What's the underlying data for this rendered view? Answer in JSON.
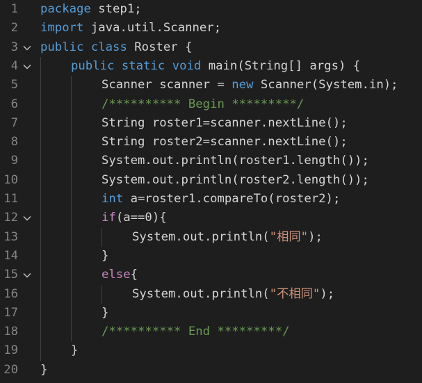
{
  "editor": {
    "language": "java",
    "lines": [
      {
        "num": "1",
        "fold": false,
        "indent": 0,
        "tokens": [
          {
            "t": "package",
            "c": "kw"
          },
          {
            "t": " step1;",
            "c": "tx"
          }
        ]
      },
      {
        "num": "2",
        "fold": false,
        "indent": 0,
        "tokens": [
          {
            "t": "import",
            "c": "kw"
          },
          {
            "t": " java.util.Scanner;",
            "c": "tx"
          }
        ]
      },
      {
        "num": "3",
        "fold": true,
        "indent": 0,
        "tokens": [
          {
            "t": "public",
            "c": "kw"
          },
          {
            "t": " ",
            "c": "tx"
          },
          {
            "t": "class",
            "c": "kw"
          },
          {
            "t": " Roster {",
            "c": "tx"
          }
        ]
      },
      {
        "num": "4",
        "fold": true,
        "indent": 1,
        "tokens": [
          {
            "t": "public",
            "c": "kw"
          },
          {
            "t": " ",
            "c": "tx"
          },
          {
            "t": "static",
            "c": "kw"
          },
          {
            "t": " ",
            "c": "tx"
          },
          {
            "t": "void",
            "c": "kw"
          },
          {
            "t": " main(String[] args) {",
            "c": "tx"
          }
        ]
      },
      {
        "num": "5",
        "fold": false,
        "indent": 2,
        "tokens": [
          {
            "t": "Scanner scanner = ",
            "c": "tx"
          },
          {
            "t": "new",
            "c": "kw"
          },
          {
            "t": " Scanner(System.in);",
            "c": "tx"
          }
        ]
      },
      {
        "num": "6",
        "fold": false,
        "indent": 2,
        "tokens": [
          {
            "t": "/********** Begin *********/",
            "c": "cmt"
          }
        ]
      },
      {
        "num": "7",
        "fold": false,
        "indent": 2,
        "tokens": [
          {
            "t": "String roster1=scanner.nextLine();",
            "c": "tx"
          }
        ]
      },
      {
        "num": "8",
        "fold": false,
        "indent": 2,
        "tokens": [
          {
            "t": "String roster2=scanner.nextLine();",
            "c": "tx"
          }
        ]
      },
      {
        "num": "9",
        "fold": false,
        "indent": 2,
        "tokens": [
          {
            "t": "System.out.println(roster1.length());",
            "c": "tx"
          }
        ]
      },
      {
        "num": "10",
        "fold": false,
        "indent": 2,
        "tokens": [
          {
            "t": "System.out.println(roster2.length());",
            "c": "tx"
          }
        ]
      },
      {
        "num": "11",
        "fold": false,
        "indent": 2,
        "tokens": [
          {
            "t": "int",
            "c": "kw"
          },
          {
            "t": " a=roster1.compareTo(roster2);",
            "c": "tx"
          }
        ]
      },
      {
        "num": "12",
        "fold": true,
        "indent": 2,
        "tokens": [
          {
            "t": "if",
            "c": "kw2"
          },
          {
            "t": "(a==0){",
            "c": "tx"
          }
        ]
      },
      {
        "num": "13",
        "fold": false,
        "indent": 3,
        "tokens": [
          {
            "t": "System.out.println(",
            "c": "tx"
          },
          {
            "t": "\"相同\"",
            "c": "str"
          },
          {
            "t": ");",
            "c": "tx"
          }
        ]
      },
      {
        "num": "14",
        "fold": false,
        "indent": 2,
        "tokens": [
          {
            "t": "}",
            "c": "tx"
          }
        ]
      },
      {
        "num": "15",
        "fold": true,
        "indent": 2,
        "tokens": [
          {
            "t": "else",
            "c": "kw2"
          },
          {
            "t": "{",
            "c": "tx"
          }
        ]
      },
      {
        "num": "16",
        "fold": false,
        "indent": 3,
        "tokens": [
          {
            "t": "System.out.println(",
            "c": "tx"
          },
          {
            "t": "\"不相同\"",
            "c": "str"
          },
          {
            "t": ");",
            "c": "tx"
          }
        ]
      },
      {
        "num": "17",
        "fold": false,
        "indent": 2,
        "tokens": [
          {
            "t": "}",
            "c": "tx"
          }
        ]
      },
      {
        "num": "18",
        "fold": false,
        "indent": 2,
        "tokens": [
          {
            "t": "/********** End *********/",
            "c": "cmt"
          }
        ]
      },
      {
        "num": "19",
        "fold": false,
        "indent": 1,
        "tokens": [
          {
            "t": "}",
            "c": "tx"
          }
        ]
      },
      {
        "num": "20",
        "fold": false,
        "indent": 0,
        "tokens": [
          {
            "t": "}",
            "c": "tx"
          }
        ]
      }
    ]
  },
  "colors": {
    "background": "#1e1e1e",
    "line_number": "#858585",
    "keyword": "#569cd6",
    "control_keyword": "#c586c0",
    "comment": "#6a9955",
    "string": "#ce9178",
    "text": "#d4d4d4",
    "indent_guide": "#404040"
  }
}
